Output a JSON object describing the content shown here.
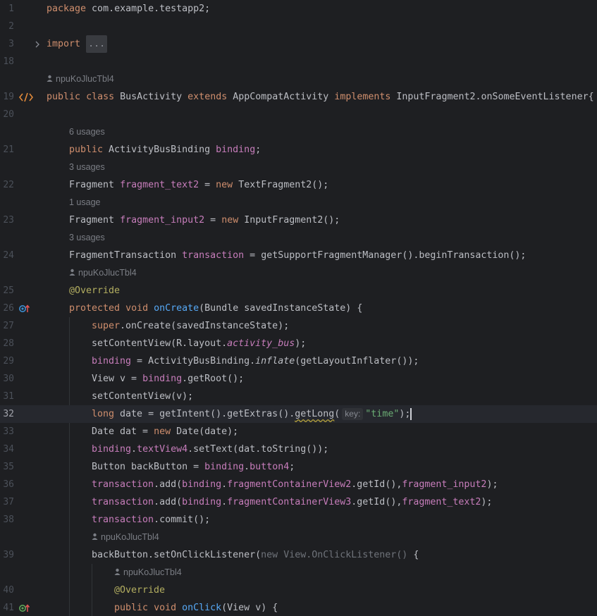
{
  "editor": {
    "current_line": "32",
    "gutter_numbers": [
      "1",
      "2",
      "3",
      "18",
      "19",
      "20",
      "21",
      "22",
      "23",
      "24",
      "25",
      "26",
      "27",
      "28",
      "29",
      "30",
      "31",
      "32",
      "33",
      "34",
      "35",
      "36",
      "37",
      "38",
      "39",
      "40",
      "41"
    ],
    "hints": {
      "author": "npuKoJlucTbl4",
      "usages_6": "6 usages",
      "usages_3": "3 usages",
      "usage_1": "1 usage"
    },
    "code": {
      "l1_kw": "package",
      "l1_rest": " com.example.testapp2;",
      "l3_kw": "import",
      "l3_fold": "...",
      "l19_public": "public",
      "l19_class": "class",
      "l19_name": " BusActivity ",
      "l19_extends": "extends",
      "l19_parent": " AppCompatActivity ",
      "l19_implements": "implements",
      "l19_iface": " InputFragment2.onSomeEventListener{",
      "l21_public": "public",
      "l21_type": " ActivityBusBinding ",
      "l21_field": "binding",
      "l21_end": ";",
      "l22_type": "Fragment ",
      "l22_field": "fragment_text2",
      "l22_eq": " = ",
      "l22_new": "new",
      "l22_rest": " TextFragment2();",
      "l23_type": "Fragment ",
      "l23_field": "fragment_input2",
      "l23_eq": " = ",
      "l23_new": "new",
      "l23_rest": " InputFragment2();",
      "l24_type": "FragmentTransaction ",
      "l24_field": "transaction",
      "l24_rest": " = getSupportFragmentManager().beginTransaction();",
      "l25_ann": "@Override",
      "l26_protected": "protected",
      "l26_void": "void",
      "l26_fn": "onCreate",
      "l26_rest": "(Bundle savedInstanceState) {",
      "l27_super": "super",
      "l27_rest": ".onCreate(savedInstanceState);",
      "l28_a": "setContentView(R.layout.",
      "l28_b": "activity_bus",
      "l28_c": ");",
      "l29_field": "binding",
      "l29_a": " = ActivityBusBinding.",
      "l29_b": "inflate",
      "l29_c": "(getLayoutInflater());",
      "l30_a": "View v = ",
      "l30_field": "binding",
      "l30_b": ".getRoot();",
      "l31": "setContentView(v);",
      "l32_long": "long",
      "l32_a": " date = getIntent().getExtras().",
      "l32_warn": "getLong",
      "l32_paren": "(",
      "l32_hint": "key:",
      "l32_str": "\"time\"",
      "l32_end": ");",
      "l33_a": "Date dat = ",
      "l33_new": "new",
      "l33_b": " Date(date);",
      "l34_field": "binding",
      "l34_dot": ".",
      "l34_tv": "textView4",
      "l34_rest": ".setText(dat.toString());",
      "l35_a": "Button backButton = ",
      "l35_field": "binding",
      "l35_dot": ".",
      "l35_btn": "button4",
      "l35_end": ";",
      "l36_tr": "transaction",
      "l36_a": ".add(",
      "l36_binding": "binding",
      "l36_dot": ".",
      "l36_fc": "fragmentContainerView2",
      "l36_b": ".getId(),",
      "l36_frag": "fragment_input2",
      "l36_end": ");",
      "l37_tr": "transaction",
      "l37_a": ".add(",
      "l37_binding": "binding",
      "l37_dot": ".",
      "l37_fc": "fragmentContainerView3",
      "l37_b": ".getId(),",
      "l37_frag": "fragment_text2",
      "l37_end": ");",
      "l38_tr": "transaction",
      "l38_rest": ".commit();",
      "l39_a": "backButton.setOnClickListener(",
      "l39_gray": "new View.OnClickListener()",
      "l39_b": " {",
      "l40_ann": "@Override",
      "l41_public": "public",
      "l41_void": "void",
      "l41_fn": "onClick",
      "l41_rest": "(View v) {"
    }
  }
}
